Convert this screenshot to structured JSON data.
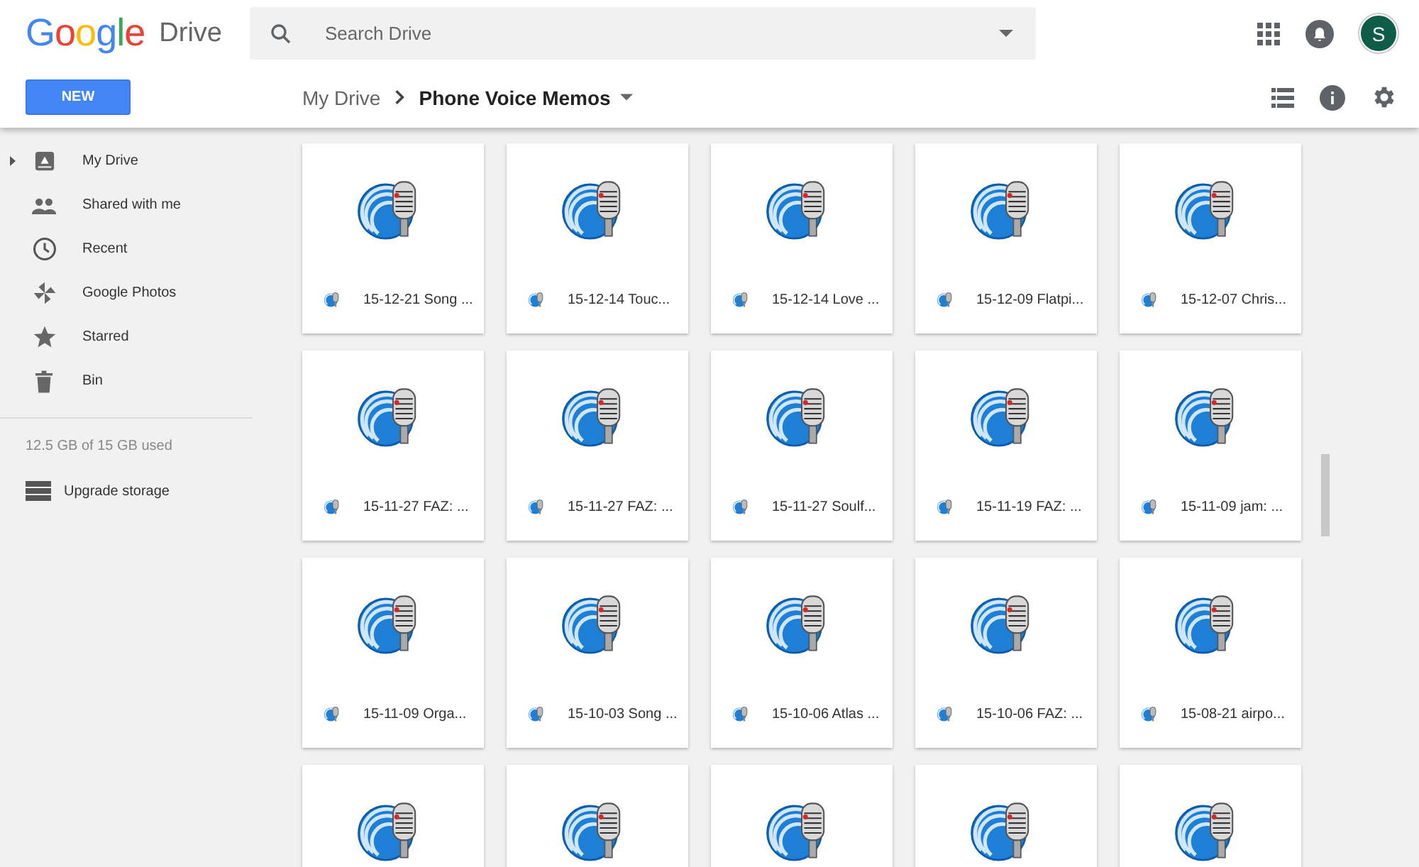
{
  "header": {
    "logo": "Google",
    "product": "Drive",
    "search": {
      "placeholder": "Search Drive"
    },
    "avatar": "S"
  },
  "toolbar": {
    "new_button": "NEW",
    "breadcrumb": [
      {
        "label": "My Drive",
        "current": false
      },
      {
        "label": "Phone Voice Memos",
        "current": true
      }
    ]
  },
  "sidebar": {
    "items": [
      {
        "label": "My Drive",
        "kind": "drive",
        "expandable": true
      },
      {
        "label": "Shared with me",
        "kind": "people",
        "expandable": false
      },
      {
        "label": "Recent",
        "kind": "clock",
        "expandable": false
      },
      {
        "label": "Google Photos",
        "kind": "pinwheel",
        "expandable": false
      },
      {
        "label": "Starred",
        "kind": "star",
        "expandable": false
      },
      {
        "label": "Bin",
        "kind": "trash",
        "expandable": false
      }
    ],
    "storage": "12.5 GB of 15 GB used",
    "upgrade": "Upgrade storage"
  },
  "files": [
    {
      "kind": "file",
      "name": "15-12-21 Song ..."
    },
    {
      "kind": "file",
      "name": "15-12-14 Touc..."
    },
    {
      "kind": "file",
      "name": "15-12-14 Love ..."
    },
    {
      "kind": "file",
      "name": "15-12-09 Flatpi..."
    },
    {
      "kind": "file",
      "name": "15-12-07 Chris..."
    },
    {
      "kind": "file",
      "name": "15-11-27 FAZ: ..."
    },
    {
      "kind": "file",
      "name": "15-11-27 FAZ: ..."
    },
    {
      "kind": "file",
      "name": "15-11-27 Soulf..."
    },
    {
      "kind": "file",
      "name": "15-11-19 FAZ: ..."
    },
    {
      "kind": "file",
      "name": "15-11-09 jam: ..."
    },
    {
      "kind": "file",
      "name": "15-11-09 Orga..."
    },
    {
      "kind": "file",
      "name": "15-10-03 Song ..."
    },
    {
      "kind": "file",
      "name": "15-10-06 Atlas ..."
    },
    {
      "kind": "file",
      "name": "15-10-06 FAZ: ..."
    },
    {
      "kind": "file",
      "name": "15-08-21 airpo..."
    },
    {
      "kind": "cut-off"
    },
    {
      "kind": "cut-off"
    },
    {
      "kind": "cut-off"
    },
    {
      "kind": "cut-off"
    },
    {
      "kind": "cut-off"
    }
  ]
}
